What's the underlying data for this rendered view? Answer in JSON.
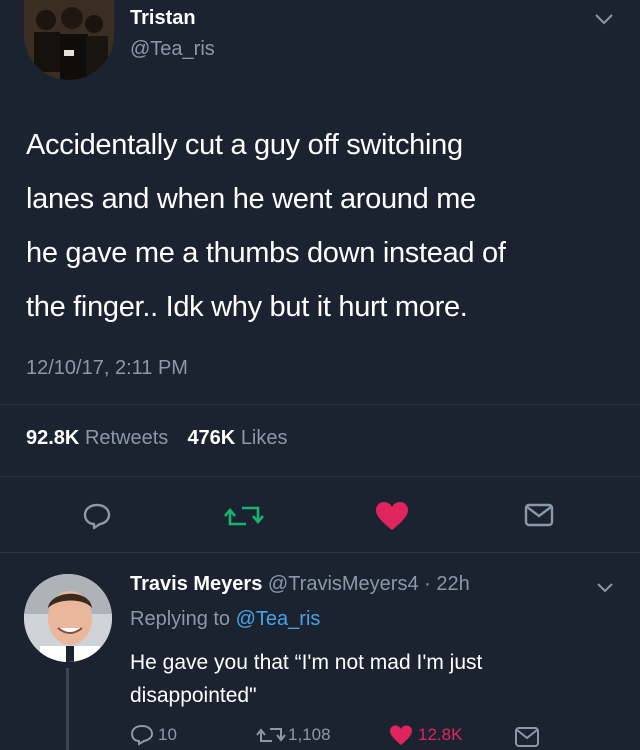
{
  "tweet": {
    "author_name": "Tristan",
    "author_handle": "@Tea_ris",
    "text_lines": [
      "Accidentally cut a guy off switching",
      "lanes and when he went around me",
      "he gave me a thumbs down instead of",
      "the finger.. Idk why but it hurt more."
    ],
    "timestamp": "12/10/17, 2:11 PM",
    "retweets_count": "92.8K",
    "retweets_label": "Retweets",
    "likes_count": "476K",
    "likes_label": "Likes",
    "actions": {
      "reply_icon": "reply-icon",
      "retweet_icon": "retweet-icon",
      "like_icon": "heart-icon",
      "share_icon": "share-icon"
    }
  },
  "reply": {
    "author_name": "Travis Meyers",
    "author_handle": "@TravisMeyers4",
    "separator": "·",
    "time_ago": "22h",
    "replying_prefix": "Replying to",
    "replying_handle": "@Tea_ris",
    "text_lines": [
      "He gave you that “I'm not mad I'm just",
      "disappointed\""
    ],
    "reply_count": "10",
    "retweet_count": "1,108",
    "like_count": "12.8K"
  },
  "colors": {
    "background": "#1b2331",
    "muted_text": "#8a98a9",
    "retweet_green": "#18b36b",
    "like_red": "#e0245e",
    "link_blue": "#4aa3e6"
  }
}
